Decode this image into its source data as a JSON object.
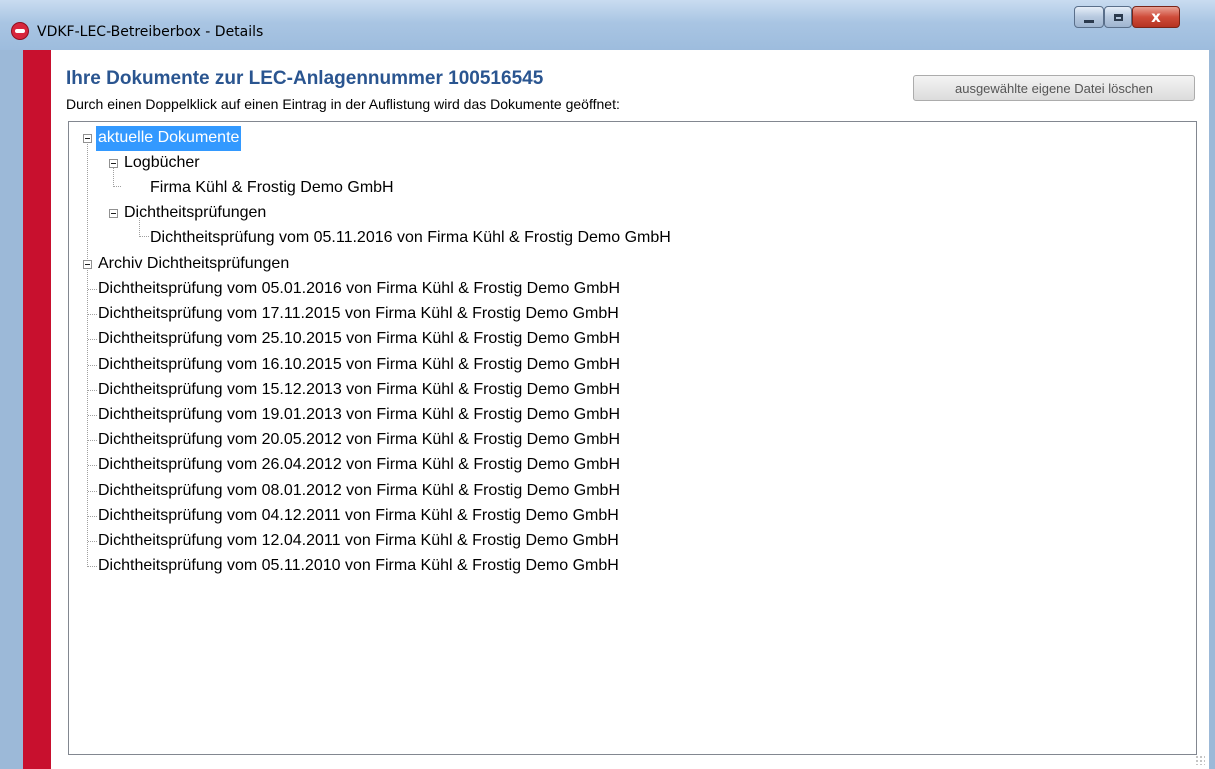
{
  "window": {
    "title": "VDKF-LEC-Betreiberbox - Details",
    "buttons": {
      "minimize": "–",
      "maximize": "□",
      "close": "x"
    }
  },
  "header": {
    "title": "Ihre Dokumente zur LEC-Anlagennummer 100516545",
    "instruction": "Durch einen Doppelklick auf einen Eintrag in der Auflistung wird das Dokumente geöffnet:",
    "delete_button": "ausgewählte eigene Datei löschen"
  },
  "tree": {
    "current": {
      "label": "aktuelle Dokumente",
      "logbooks": {
        "label": "Logbücher",
        "items": [
          "Firma Kühl & Frostig Demo GmbH"
        ]
      },
      "tests": {
        "label": "Dichtheitsprüfungen",
        "items": [
          "Dichtheitsprüfung vom 05.11.2016 von Firma Kühl & Frostig Demo GmbH"
        ]
      }
    },
    "archive": {
      "label": "Archiv Dichtheitsprüfungen",
      "items": [
        "Dichtheitsprüfung vom 05.01.2016 von Firma Kühl & Frostig Demo GmbH",
        "Dichtheitsprüfung vom 17.11.2015 von Firma Kühl & Frostig Demo GmbH",
        "Dichtheitsprüfung vom 25.10.2015 von Firma Kühl & Frostig Demo GmbH",
        "Dichtheitsprüfung vom 16.10.2015 von Firma Kühl & Frostig Demo GmbH",
        "Dichtheitsprüfung vom 15.12.2013 von Firma Kühl & Frostig Demo GmbH",
        "Dichtheitsprüfung vom 19.01.2013 von Firma Kühl & Frostig Demo GmbH",
        "Dichtheitsprüfung vom 20.05.2012 von Firma Kühl & Frostig Demo GmbH",
        "Dichtheitsprüfung vom 26.04.2012 von Firma Kühl & Frostig Demo GmbH",
        "Dichtheitsprüfung vom 08.01.2012 von Firma Kühl & Frostig Demo GmbH",
        "Dichtheitsprüfung vom 04.12.2011 von Firma Kühl & Frostig Demo GmbH",
        "Dichtheitsprüfung vom 12.04.2011 von Firma Kühl & Frostig Demo GmbH",
        "Dichtheitsprüfung vom 05.11.2010 von Firma Kühl & Frostig Demo GmbH"
      ]
    }
  },
  "colors": {
    "accent_stripe": "#c8102e",
    "heading": "#2a5590",
    "selection": "#3399ff"
  }
}
